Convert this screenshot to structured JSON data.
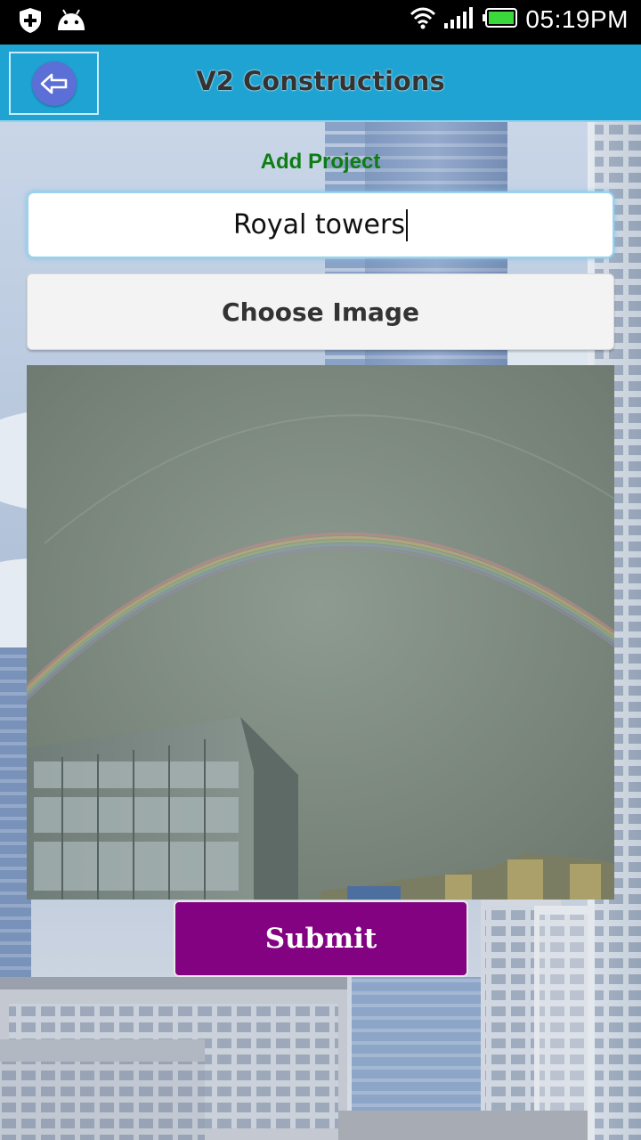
{
  "status_bar": {
    "time": "05:19PM",
    "icons": [
      "shield-plus-icon",
      "android-icon",
      "wifi-icon",
      "signal-icon",
      "battery-icon"
    ],
    "battery_color": "#3bd83b"
  },
  "app_bar": {
    "title": "V2 Constructions",
    "back_icon": "back-arrow-icon",
    "background": "#1ea3d2"
  },
  "form": {
    "heading": "Add Project",
    "project_name_value": "Royal towers",
    "choose_image_label": "Choose Image",
    "submit_label": "Submit",
    "heading_color": "#0d7d14",
    "submit_color": "#820282"
  },
  "preview_image": {
    "subject": "rainbow over building"
  }
}
